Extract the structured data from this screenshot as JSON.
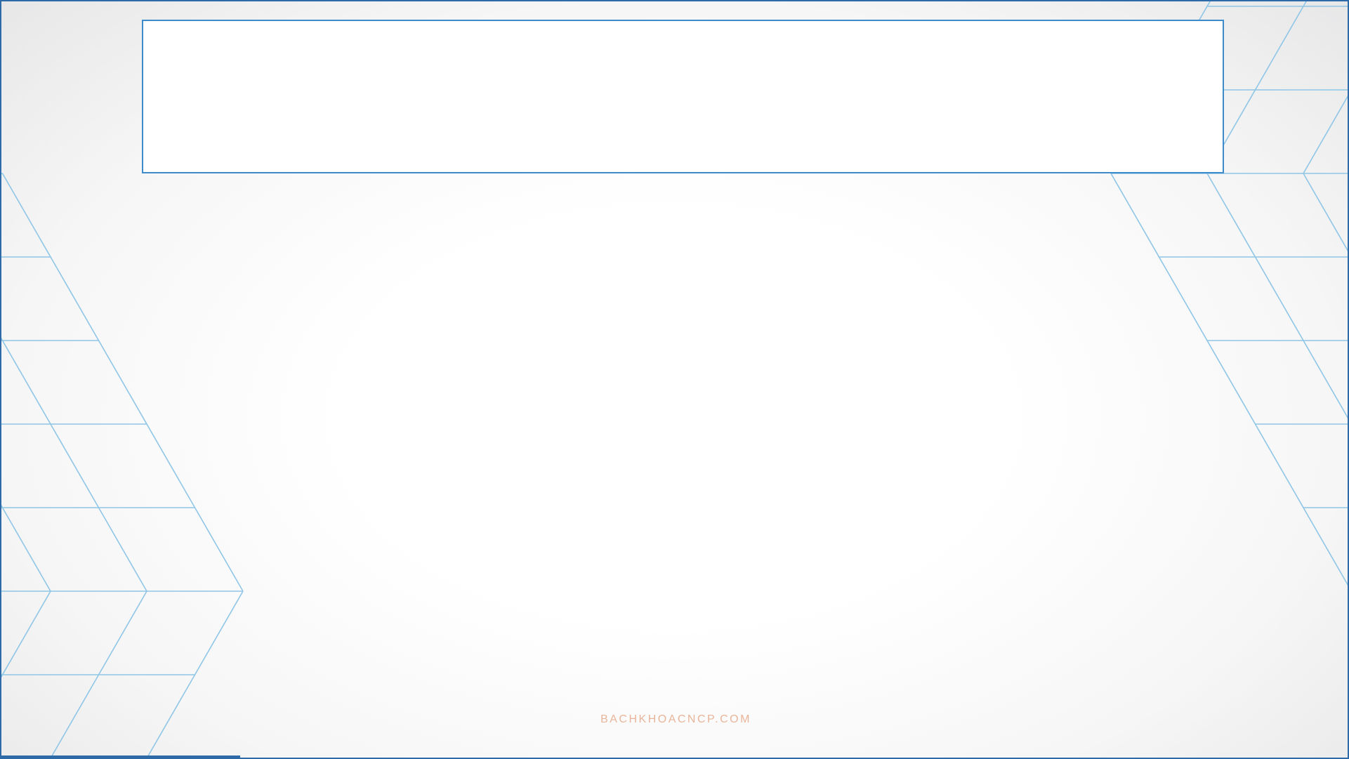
{
  "slide": {
    "watermark": "BACHKHOACNCP.COM"
  },
  "colors": {
    "frame_border": "#2f6aa8",
    "title_box_border": "#3d8bcb",
    "triangle_lines": "#8fc6e6",
    "watermark": "#e9b59a"
  },
  "decorations": {
    "left": "triangle-lattice",
    "right": "triangle-lattice"
  }
}
